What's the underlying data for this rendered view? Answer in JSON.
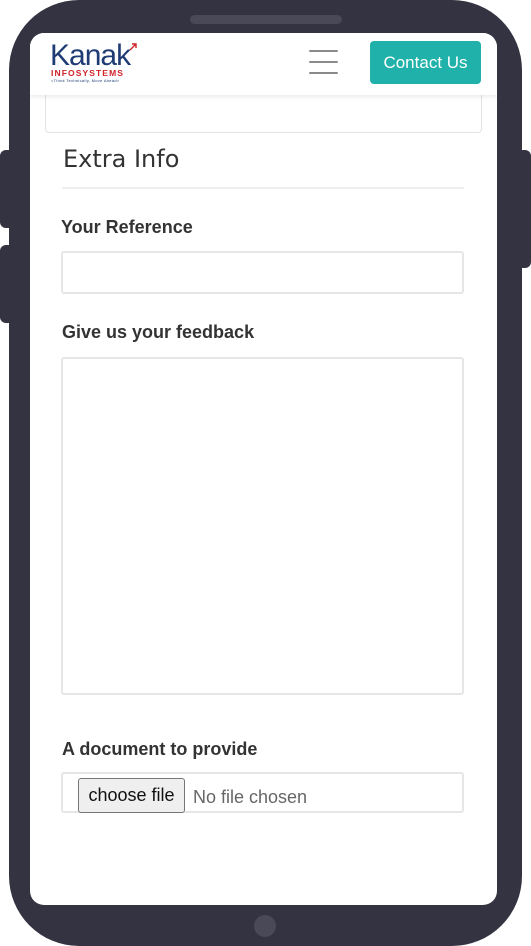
{
  "brand": {
    "name": "Kanak",
    "subtitle": "INFOSYSTEMS",
    "tagline": "<Think Technically, Move Ahead>",
    "primary_color": "#1f3b73",
    "accent_color": "#d0232a"
  },
  "navbar": {
    "menu_icon": "hamburger-icon",
    "contact_label": "Contact Us",
    "contact_color": "#20b2aa"
  },
  "form": {
    "section_title": "Extra Info",
    "reference": {
      "label": "Your Reference",
      "value": ""
    },
    "feedback": {
      "label": "Give us your feedback",
      "value": ""
    },
    "document": {
      "label": "A document to provide",
      "button_label": "choose file",
      "status": "No file chosen"
    }
  }
}
